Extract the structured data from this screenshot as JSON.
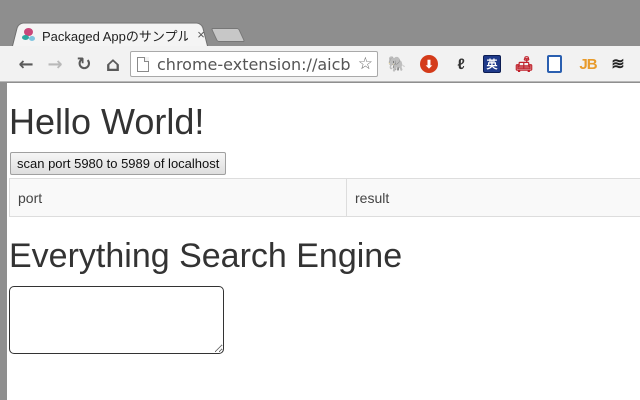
{
  "browser": {
    "tab": {
      "title": "Packaged Appのサンプル",
      "close_glyph": "×",
      "favicon": "packaged-app-icon"
    },
    "toolbar": {
      "back_glyph": "←",
      "forward_glyph": "→",
      "reload_glyph": "↻",
      "home_glyph": "⌂",
      "url": "chrome-extension://aicb",
      "star_glyph": "☆"
    },
    "extensions": [
      {
        "name": "evernote-icon",
        "glyph": "🐘"
      },
      {
        "name": "adblock-icon",
        "glyph": "⬇"
      },
      {
        "name": "feather-icon",
        "glyph": "ℓ"
      },
      {
        "name": "eiji-icon",
        "glyph": "英"
      },
      {
        "name": "sofa-icon",
        "glyph": "🛋"
      },
      {
        "name": "document-icon",
        "glyph": ""
      },
      {
        "name": "jb-icon",
        "glyph": "JB"
      },
      {
        "name": "buffer-icon",
        "glyph": "≋"
      }
    ]
  },
  "page": {
    "heading": "Hello World!",
    "scan_button_label": "scan port 5980 to 5989 of localhost",
    "table": {
      "headers": [
        "port",
        "result"
      ]
    },
    "search_heading": "Everything Search Engine",
    "search_value": ""
  }
}
